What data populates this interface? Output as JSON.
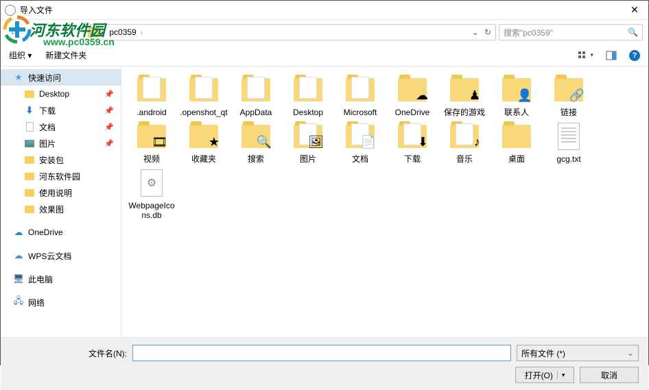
{
  "title": "导入文件",
  "watermark": {
    "brand": "河东软件园",
    "url": "www.pc0359.cn"
  },
  "nav": {
    "path_segment": "pc0359",
    "search_placeholder": "搜索\"pc0359\""
  },
  "toolbar": {
    "organize": "组织 ▾",
    "new_folder": "新建文件夹"
  },
  "sidebar": {
    "quick": "快速访问",
    "desktop": "Desktop",
    "downloads": "下载",
    "documents": "文档",
    "pictures": "图片",
    "pkg": "安装包",
    "hedong": "河东软件园",
    "usage": "使用说明",
    "effect": "效果图",
    "onedrive": "OneDrive",
    "wps": "WPS云文档",
    "thispc": "此电脑",
    "network": "网络"
  },
  "items": {
    "r0": [
      ".android",
      ".openshot_qt",
      "AppData",
      "Desktop",
      "Microsoft",
      "OneDrive",
      "保存的游戏",
      "联系人",
      "链接",
      "视频"
    ],
    "r1": [
      "收藏夹",
      "搜索",
      "图片",
      "文档",
      "下载",
      "音乐",
      "桌面",
      "gcg.txt",
      "WebpageIcons.db"
    ]
  },
  "footer": {
    "filename_label": "文件名(N):",
    "filetype": "所有文件 (*)",
    "open": "打开(O)",
    "cancel": "取消"
  }
}
